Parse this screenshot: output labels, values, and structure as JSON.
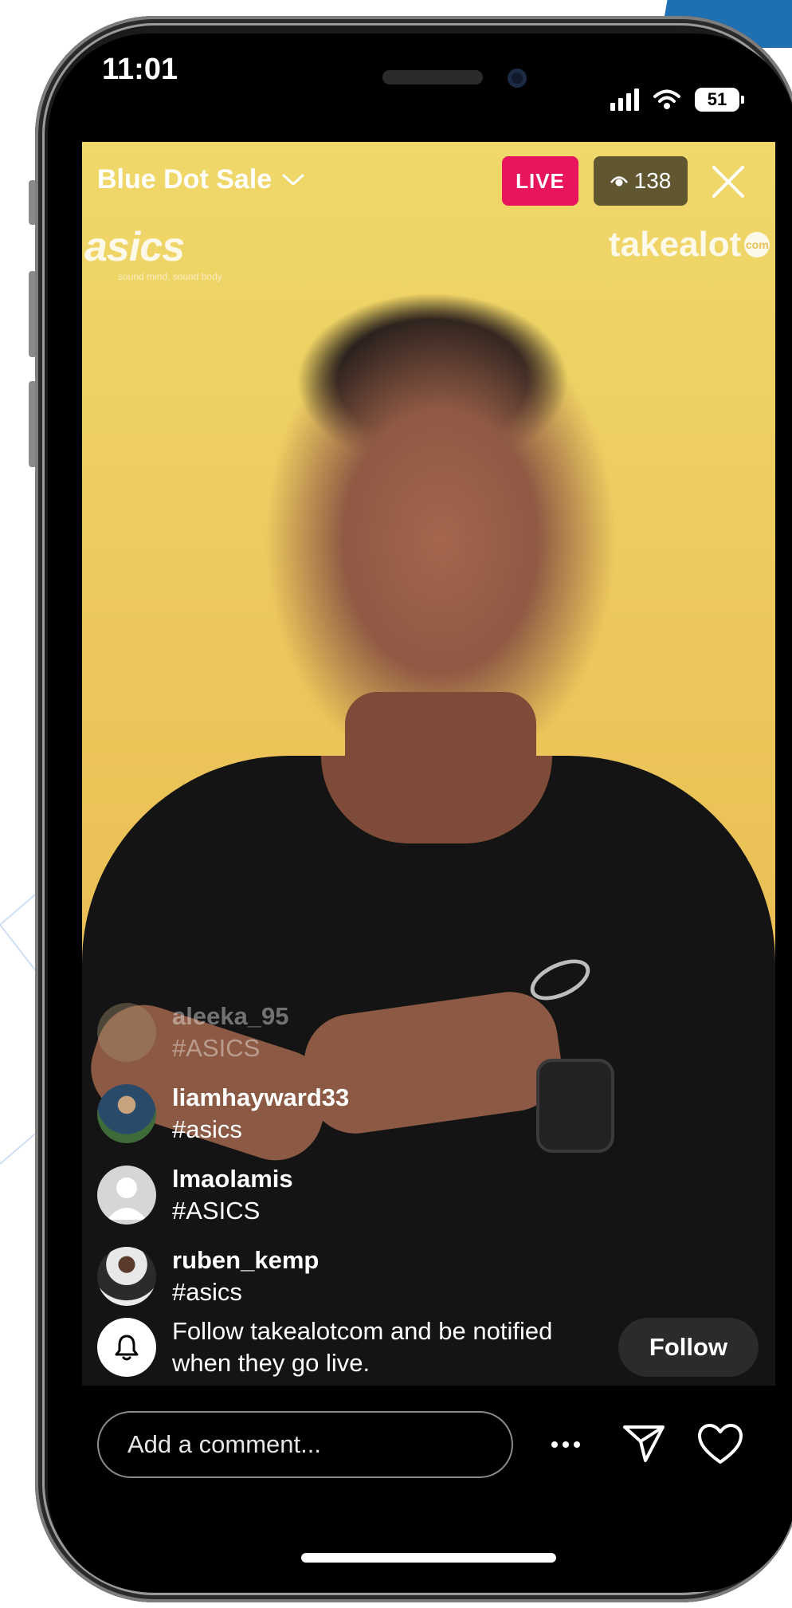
{
  "status_bar": {
    "time": "11:01",
    "battery": "51",
    "icons": [
      "signal-icon",
      "wifi-icon",
      "battery-icon"
    ]
  },
  "live": {
    "title": "Blue Dot Sale",
    "live_label": "LIVE",
    "viewers": "138"
  },
  "overlays": {
    "brand_left": "asics",
    "brand_left_tagline": "sound mind, sound body",
    "brand_right": "takealot",
    "brand_right_suffix": "com"
  },
  "comments": [
    {
      "user": "aleeka_95",
      "text": "#ASICS",
      "faded": true
    },
    {
      "user": "liamhayward33",
      "text": "#asics",
      "faded": false
    },
    {
      "user": "lmaolamis",
      "text": "#ASICS",
      "faded": false
    },
    {
      "user": "ruben_kemp",
      "text": "#asics",
      "faded": false
    }
  ],
  "follow_prompt": {
    "text": "Follow takealotcom and be notified when they go live.",
    "button": "Follow"
  },
  "bottom_bar": {
    "comment_placeholder": "Add a comment...",
    "more_icon": "more-icon",
    "send_icon": "send-icon",
    "like_icon": "heart-icon"
  },
  "colors": {
    "live_badge": "#e8155e",
    "accent_blue": "#1f6fb3"
  }
}
